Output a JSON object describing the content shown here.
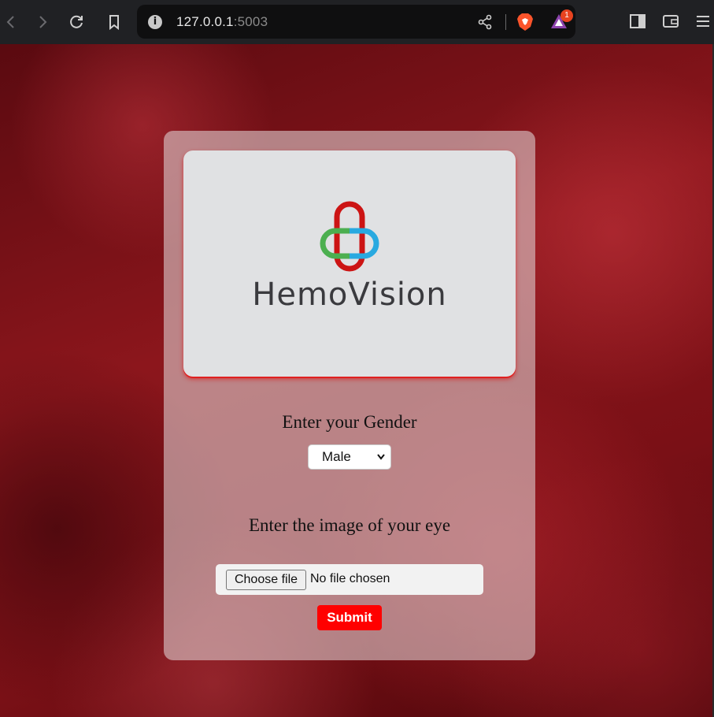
{
  "browser": {
    "url_host": "127.0.0.1",
    "url_port": ":5003",
    "notification_count": "1",
    "icons": [
      "back-icon",
      "forward-icon",
      "reload-icon",
      "bookmark-icon",
      "info-icon",
      "share-icon",
      "brave-shield-icon",
      "brave-rewards-icon",
      "sidebar-icon",
      "wallet-icon",
      "menu-icon"
    ]
  },
  "logo": {
    "text": "HemoVision",
    "colors": {
      "red": "#cc1414",
      "green": "#4caf50",
      "blue": "#29a9e0"
    }
  },
  "form": {
    "gender_label": "Enter your Gender",
    "gender_selected": "Male",
    "image_label": "Enter the image of your eye",
    "file_button": "Choose file",
    "file_status": "No file chosen",
    "submit_label": "Submit"
  },
  "colors": {
    "submit_bg": "#ff0000",
    "logo_shadow": "#e02020"
  }
}
